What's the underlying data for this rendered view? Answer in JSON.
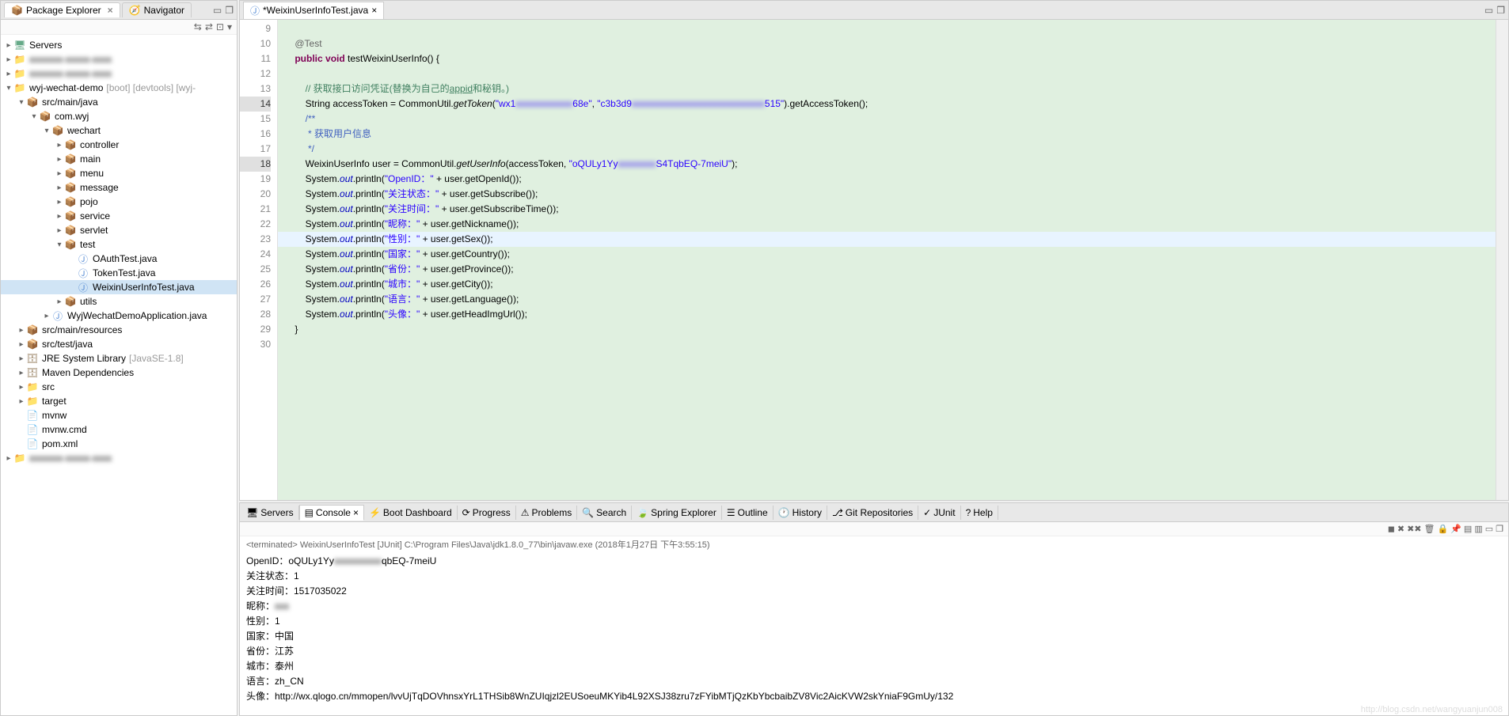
{
  "leftPanel": {
    "tabs": [
      {
        "label": "Package Explorer",
        "active": true,
        "icon": "package-explorer-icon"
      },
      {
        "label": "Navigator",
        "active": false,
        "icon": "navigator-icon"
      }
    ],
    "tree": [
      {
        "indent": 0,
        "expand": "▸",
        "icon": "server",
        "label": "Servers"
      },
      {
        "indent": 0,
        "expand": "▸",
        "icon": "project",
        "label": "",
        "blurred": true
      },
      {
        "indent": 0,
        "expand": "▸",
        "icon": "project",
        "label": "",
        "blurred": true
      },
      {
        "indent": 0,
        "expand": "▾",
        "icon": "project",
        "label": "wyj-wechat-demo",
        "decorator": "[boot] [devtools] [wyj-"
      },
      {
        "indent": 1,
        "expand": "▾",
        "icon": "package",
        "label": "src/main/java"
      },
      {
        "indent": 2,
        "expand": "▾",
        "icon": "package",
        "label": "com.wyj"
      },
      {
        "indent": 3,
        "expand": "▾",
        "icon": "package",
        "label": "wechart"
      },
      {
        "indent": 4,
        "expand": "▸",
        "icon": "package",
        "label": "controller"
      },
      {
        "indent": 4,
        "expand": "▸",
        "icon": "package",
        "label": "main"
      },
      {
        "indent": 4,
        "expand": "▸",
        "icon": "package",
        "label": "menu"
      },
      {
        "indent": 4,
        "expand": "▸",
        "icon": "package",
        "label": "message"
      },
      {
        "indent": 4,
        "expand": "▸",
        "icon": "package",
        "label": "pojo"
      },
      {
        "indent": 4,
        "expand": "▸",
        "icon": "package",
        "label": "service"
      },
      {
        "indent": 4,
        "expand": "▸",
        "icon": "package",
        "label": "servlet"
      },
      {
        "indent": 4,
        "expand": "▾",
        "icon": "package",
        "label": "test"
      },
      {
        "indent": 5,
        "expand": "",
        "icon": "java",
        "label": "OAuthTest.java"
      },
      {
        "indent": 5,
        "expand": "",
        "icon": "java",
        "label": "TokenTest.java"
      },
      {
        "indent": 5,
        "expand": "",
        "icon": "java",
        "label": "WeixinUserInfoTest.java",
        "selected": true
      },
      {
        "indent": 4,
        "expand": "▸",
        "icon": "package",
        "label": "utils"
      },
      {
        "indent": 3,
        "expand": "▸",
        "icon": "java",
        "label": "WyjWechatDemoApplication.java"
      },
      {
        "indent": 1,
        "expand": "▸",
        "icon": "package",
        "label": "src/main/resources"
      },
      {
        "indent": 1,
        "expand": "▸",
        "icon": "package",
        "label": "src/test/java"
      },
      {
        "indent": 1,
        "expand": "▸",
        "icon": "jar",
        "label": "JRE System Library",
        "decorator": "[JavaSE-1.8]"
      },
      {
        "indent": 1,
        "expand": "▸",
        "icon": "jar",
        "label": "Maven Dependencies"
      },
      {
        "indent": 1,
        "expand": "▸",
        "icon": "folder",
        "label": "src"
      },
      {
        "indent": 1,
        "expand": "▸",
        "icon": "folder",
        "label": "target"
      },
      {
        "indent": 1,
        "expand": "",
        "icon": "file",
        "label": "mvnw"
      },
      {
        "indent": 1,
        "expand": "",
        "icon": "file",
        "label": "mvnw.cmd"
      },
      {
        "indent": 1,
        "expand": "",
        "icon": "file",
        "label": "pom.xml"
      },
      {
        "indent": 0,
        "expand": "▸",
        "icon": "project",
        "label": "",
        "blurred": true
      }
    ]
  },
  "editor": {
    "tabTitle": "*WeixinUserInfoTest.java",
    "lines": [
      {
        "num": 9,
        "html": ""
      },
      {
        "num": 10,
        "html": "    <span class='anno'>@Test</span>"
      },
      {
        "num": 11,
        "html": "    <span class='kw'>public</span> <span class='kw'>void</span> testWeixinUserInfo() {"
      },
      {
        "num": 12,
        "html": ""
      },
      {
        "num": 13,
        "html": "        <span class='comment'>// 获取接口访问凭证(替换为自己的<u>appid</u>和秘钥。)</span>"
      },
      {
        "num": 14,
        "html": "        String accessToken = CommonUtil.<i>getToken</i>(<span class='str'>\"wx1</span><span class='str blur'>xxxxxxxxxxxx</span><span class='str'>68e\"</span>, <span class='str'>\"c3b3d9</span><span class='str blur'>xxxxxxxxxxxxxxxxxxxxxxxxxxxx</span><span class='str'>515\"</span>).getAccessToken();",
        "dirty": true
      },
      {
        "num": 15,
        "html": "        <span class='doc'>/**</span>"
      },
      {
        "num": 16,
        "html": "<span class='doc'>         * 获取用户信息</span>"
      },
      {
        "num": 17,
        "html": "<span class='doc'>         */</span>"
      },
      {
        "num": 18,
        "html": "        WeixinUserInfo user = CommonUtil.<i>getUserInfo</i>(accessToken, <span class='str'>\"oQULy1Yy</span><span class='str blur'>xxxxxxxx</span><span class='str'>S4TqbEQ-7meiU\"</span>);",
        "dirty": true
      },
      {
        "num": 19,
        "html": "        System.<span class='static-field'>out</span>.println(<span class='str'>\"OpenID：\"</span> + user.getOpenId());"
      },
      {
        "num": 20,
        "html": "        System.<span class='static-field'>out</span>.println(<span class='str'>\"关注状态：\"</span> + user.getSubscribe());"
      },
      {
        "num": 21,
        "html": "        System.<span class='static-field'>out</span>.println(<span class='str'>\"关注时间：\"</span> + user.getSubscribeTime());"
      },
      {
        "num": 22,
        "html": "        System.<span class='static-field'>out</span>.println(<span class='str'>\"昵称：\"</span> + user.getNickname());"
      },
      {
        "num": 23,
        "html": "        System.<span class='static-field'>out</span>.println(<span class='str'>\"性别：\"</span> + user.getSex());",
        "current": true
      },
      {
        "num": 24,
        "html": "        System.<span class='static-field'>out</span>.println(<span class='str'>\"国家：\"</span> + user.getCountry());"
      },
      {
        "num": 25,
        "html": "        System.<span class='static-field'>out</span>.println(<span class='str'>\"省份：\"</span> + user.getProvince());"
      },
      {
        "num": 26,
        "html": "        System.<span class='static-field'>out</span>.println(<span class='str'>\"城市：\"</span> + user.getCity());"
      },
      {
        "num": 27,
        "html": "        System.<span class='static-field'>out</span>.println(<span class='str'>\"语言：\"</span> + user.getLanguage());"
      },
      {
        "num": 28,
        "html": "        System.<span class='static-field'>out</span>.println(<span class='str'>\"头像：\"</span> + user.getHeadImgUrl());"
      },
      {
        "num": 29,
        "html": "    }"
      },
      {
        "num": 30,
        "html": ""
      }
    ]
  },
  "console": {
    "tabs": [
      "Servers",
      "Console",
      "Boot Dashboard",
      "Progress",
      "Problems",
      "Search",
      "Spring Explorer",
      "Outline",
      "History",
      "Git Repositories",
      "JUnit",
      "Help"
    ],
    "activeTab": "Console",
    "status": "<terminated> WeixinUserInfoTest [JUnit] C:\\Program Files\\Java\\jdk1.8.0_77\\bin\\javaw.exe (2018年1月27日 下午3:55:15)",
    "output": [
      {
        "text": "OpenID：oQULy1Yy",
        "blur": "xxxxxxxxxx",
        "rest": "qbEQ-7meiU"
      },
      {
        "text": "关注状态：1"
      },
      {
        "text": "关注时间：1517035022"
      },
      {
        "text": "昵称：",
        "blur": "xxx"
      },
      {
        "text": "性别：1"
      },
      {
        "text": "国家：中国"
      },
      {
        "text": "省份：江苏"
      },
      {
        "text": "城市：泰州"
      },
      {
        "text": "语言：zh_CN"
      },
      {
        "text": "头像：http://wx.qlogo.cn/mmopen/lvvUjTqDOVhnsxYrL1THSib8WnZUIqjzl2EUSoeuMKYib4L92XSJ38zru7zFYibMTjQzKbYbcbaibZV8Vic2AicKVW2skYniaF9GmUy/132"
      }
    ]
  },
  "watermark": "http://blog.csdn.net/wangyuanjun008"
}
